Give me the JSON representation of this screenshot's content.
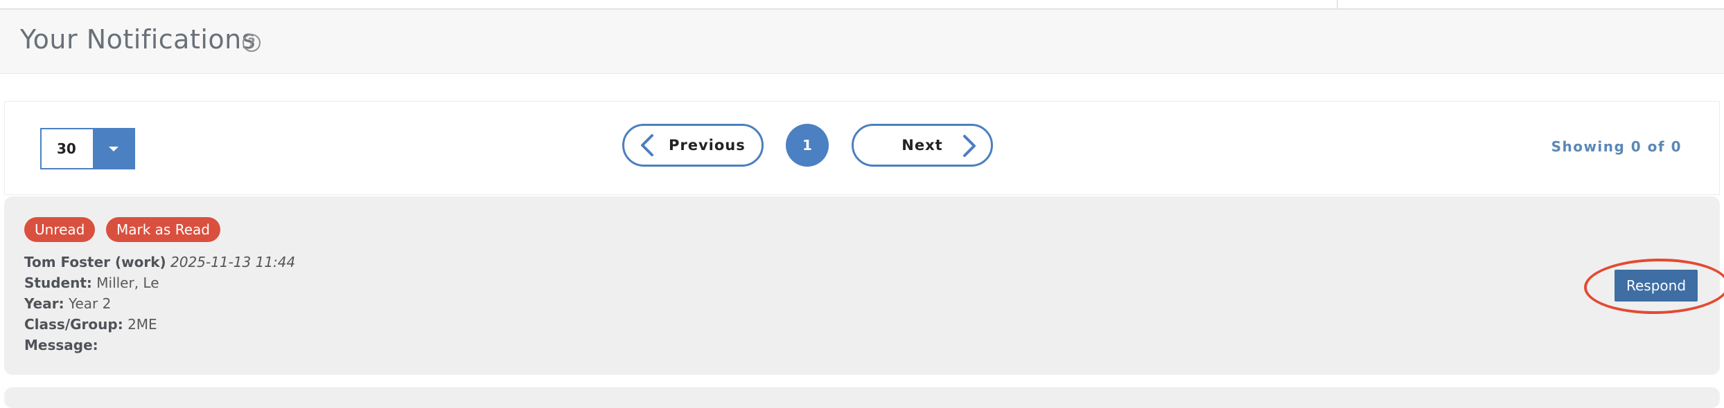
{
  "header": {
    "title": "Your Notifications",
    "help_symbol": "?"
  },
  "pagination": {
    "per_page": "30",
    "previous_label": "Previous",
    "next_label": "Next",
    "current_page": "1",
    "showing_text": "Showing 0 of 0"
  },
  "notification": {
    "status_badge": "Unread",
    "mark_read_label": "Mark as Read",
    "sender": "Tom Foster (work)",
    "date": "2025-11-13 11:44",
    "student_label": "Student:",
    "student_value": "Miller, Le",
    "year_label": "Year:",
    "year_value": "Year 2",
    "class_label": "Class/Group:",
    "class_value": "2ME",
    "message_label": "Message:",
    "message_value": "",
    "respond_label": "Respond"
  },
  "colors": {
    "accent_blue": "#4b80c2",
    "badge_red": "#d9503e",
    "respond_blue": "#3e6ea3",
    "highlight_ring": "#e24a33"
  },
  "icons": {
    "help": "question-circle-icon",
    "prev": "chevron-left-icon",
    "next": "chevron-right-icon",
    "dropdown": "caret-down-icon"
  }
}
